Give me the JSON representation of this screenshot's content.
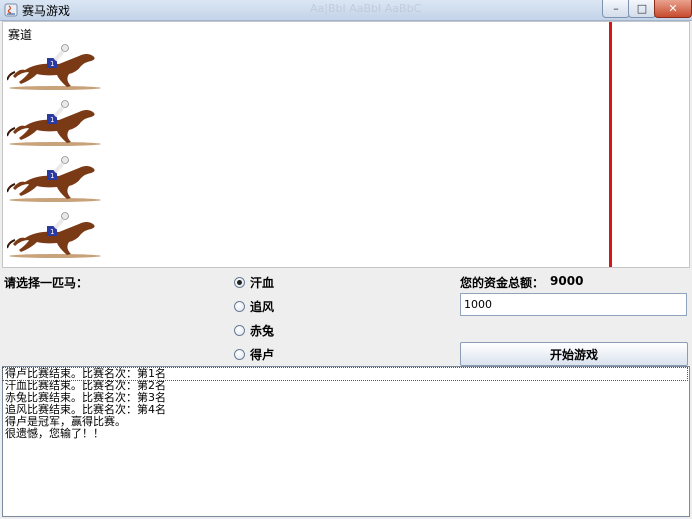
{
  "window": {
    "title": "赛马游戏",
    "ghost_text": "Aa|BbI AaBbI AaBbC"
  },
  "window_buttons": {
    "minimize": "–",
    "maximize": "□",
    "close": "✕"
  },
  "track": {
    "label": "赛道",
    "horses": [
      "horse-1",
      "horse-2",
      "horse-3",
      "horse-4"
    ],
    "finish_color": "#d01818"
  },
  "controls": {
    "prompt": "请选择一匹马：",
    "options": [
      {
        "label": "汗血",
        "checked": true
      },
      {
        "label": "追风",
        "checked": false
      },
      {
        "label": "赤兔",
        "checked": false
      },
      {
        "label": "得卢",
        "checked": false
      }
    ],
    "funds_label": "您的资金总额：",
    "funds_value": "9000",
    "bet_value": "1000",
    "start_label": "开始游戏"
  },
  "log": {
    "lines": [
      "得卢比赛结束。比赛名次：第1名",
      "汗血比赛结束。比赛名次：第2名",
      "赤兔比赛结束。比赛名次：第3名",
      "追风比赛结束。比赛名次：第4名",
      "得卢是冠军，赢得比赛。",
      "很遗憾，您输了！！"
    ]
  }
}
